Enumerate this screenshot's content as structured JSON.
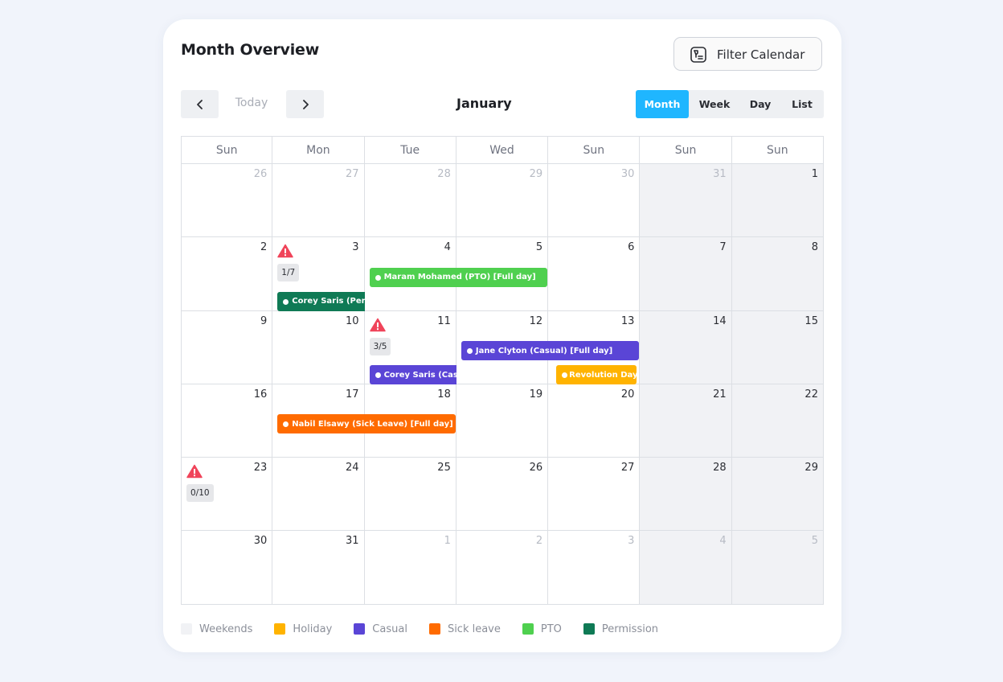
{
  "header": {
    "title": "Month Overview",
    "filter_label": "Filter Calendar"
  },
  "nav": {
    "today_label": "Today",
    "month_title": "January"
  },
  "views": [
    {
      "label": "Month",
      "active": true
    },
    {
      "label": "Week",
      "active": false
    },
    {
      "label": "Day",
      "active": false
    },
    {
      "label": "List",
      "active": false
    }
  ],
  "weekdays": [
    "Sun",
    "Mon",
    "Tue",
    "Wed",
    "Sun",
    "Sun",
    "Sun"
  ],
  "weeks": [
    [
      {
        "n": "26",
        "muted": true
      },
      {
        "n": "27",
        "muted": true
      },
      {
        "n": "28",
        "muted": true
      },
      {
        "n": "29",
        "muted": true
      },
      {
        "n": "30",
        "muted": true
      },
      {
        "n": "31",
        "muted": true,
        "weekend": true
      },
      {
        "n": "1",
        "weekend": true
      }
    ],
    [
      {
        "n": "2"
      },
      {
        "n": "3",
        "warn": true,
        "count": "1/7"
      },
      {
        "n": "4"
      },
      {
        "n": "5"
      },
      {
        "n": "6"
      },
      {
        "n": "7",
        "weekend": true
      },
      {
        "n": "8",
        "weekend": true
      }
    ],
    [
      {
        "n": "9"
      },
      {
        "n": "10"
      },
      {
        "n": "11",
        "warn": true,
        "count": "3/5"
      },
      {
        "n": "12"
      },
      {
        "n": "13"
      },
      {
        "n": "14",
        "weekend": true
      },
      {
        "n": "15",
        "weekend": true
      }
    ],
    [
      {
        "n": "16"
      },
      {
        "n": "17"
      },
      {
        "n": "18"
      },
      {
        "n": "19"
      },
      {
        "n": "20"
      },
      {
        "n": "21",
        "weekend": true
      },
      {
        "n": "22",
        "weekend": true
      }
    ],
    [
      {
        "n": "23",
        "warn": true,
        "count": "0/10"
      },
      {
        "n": "24"
      },
      {
        "n": "25"
      },
      {
        "n": "26"
      },
      {
        "n": "27"
      },
      {
        "n": "28",
        "weekend": true
      },
      {
        "n": "29",
        "weekend": true
      }
    ],
    [
      {
        "n": "30"
      },
      {
        "n": "31"
      },
      {
        "n": "1",
        "muted": true
      },
      {
        "n": "2",
        "muted": true
      },
      {
        "n": "3",
        "muted": true
      },
      {
        "n": "4",
        "muted": true,
        "weekend": true
      },
      {
        "n": "5",
        "muted": true,
        "weekend": true
      }
    ]
  ],
  "events": [
    {
      "label": "Maram Mohamed  (PTO) [Full day]",
      "type": "pto",
      "week": 1,
      "start": 2,
      "span": 2,
      "slot": 0
    },
    {
      "label": "Corey Saris (Permission)",
      "type": "permission",
      "week": 1,
      "start": 1,
      "span": 1,
      "slot": 1
    },
    {
      "label": "Jane Clyton  (Casual) [Full day]",
      "type": "casual",
      "week": 2,
      "start": 3,
      "span": 2,
      "slot": 0
    },
    {
      "label": "Corey Saris (Casual)",
      "type": "casual",
      "week": 2,
      "start": 2,
      "span": 1,
      "slot": 1
    },
    {
      "label": "Revolution Day",
      "type": "holiday",
      "week": 2,
      "start": 4,
      "span": 1,
      "slot": 1
    },
    {
      "label": "Nabil Elsawy  (Sick Leave) [Full day]",
      "type": "sick",
      "week": 3,
      "start": 1,
      "span": 2,
      "slot": 0
    }
  ],
  "colors": {
    "weekends": "#f1f2f5",
    "holiday": "#ffb300",
    "casual": "#5a45d6",
    "sick": "#ff6b00",
    "pto": "#4fd04f",
    "permission": "#0f7a55",
    "accent": "#1fb6ff",
    "warning": "#f0445a"
  },
  "legend": [
    {
      "label": "Weekends",
      "color": "#f1f2f5"
    },
    {
      "label": "Holiday",
      "color": "#ffb300"
    },
    {
      "label": "Casual",
      "color": "#5a45d6"
    },
    {
      "label": "Sick leave",
      "color": "#ff6b00"
    },
    {
      "label": "PTO",
      "color": "#4fd04f"
    },
    {
      "label": "Permission",
      "color": "#0f7a55"
    }
  ]
}
